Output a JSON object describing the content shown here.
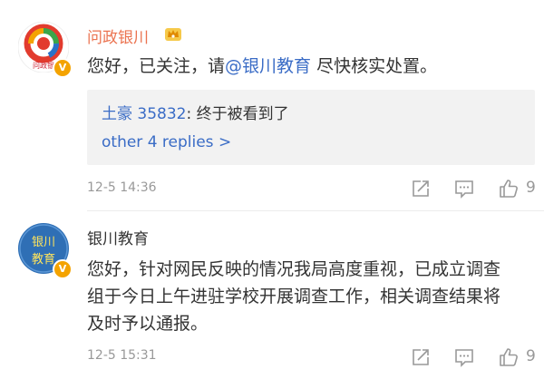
{
  "comments": [
    {
      "author": "问政银川",
      "avatar_text": "问政银",
      "text_before": "您好，已关注，请",
      "mention": "@银川教育",
      "text_after": " 尽快核实处置。",
      "reply": {
        "user": "土豪 35832",
        "separator": ":",
        "text": " 终于被看到了"
      },
      "more_replies": "other 4 replies >",
      "time": "12-5 14:36",
      "likes": "9"
    },
    {
      "author": "银川教育",
      "avatar_text_top": "银川",
      "avatar_text_bottom": "教育",
      "text": "您好，针对网民反映的情况我局高度重视，已成立调查组于今日上午进驻学校开展调查工作，相关调查结果将及时予以通报。",
      "time": "12-5 15:31",
      "likes": "9"
    }
  ],
  "colors": {
    "name_orange": "#eb7350",
    "link_blue": "#3a6cc6",
    "meta_gray": "#999999",
    "verified_gold": "#f4a300"
  },
  "icons": [
    "crown-badge-icon",
    "verified-badge-icon",
    "share-icon",
    "comment-icon",
    "like-icon"
  ]
}
